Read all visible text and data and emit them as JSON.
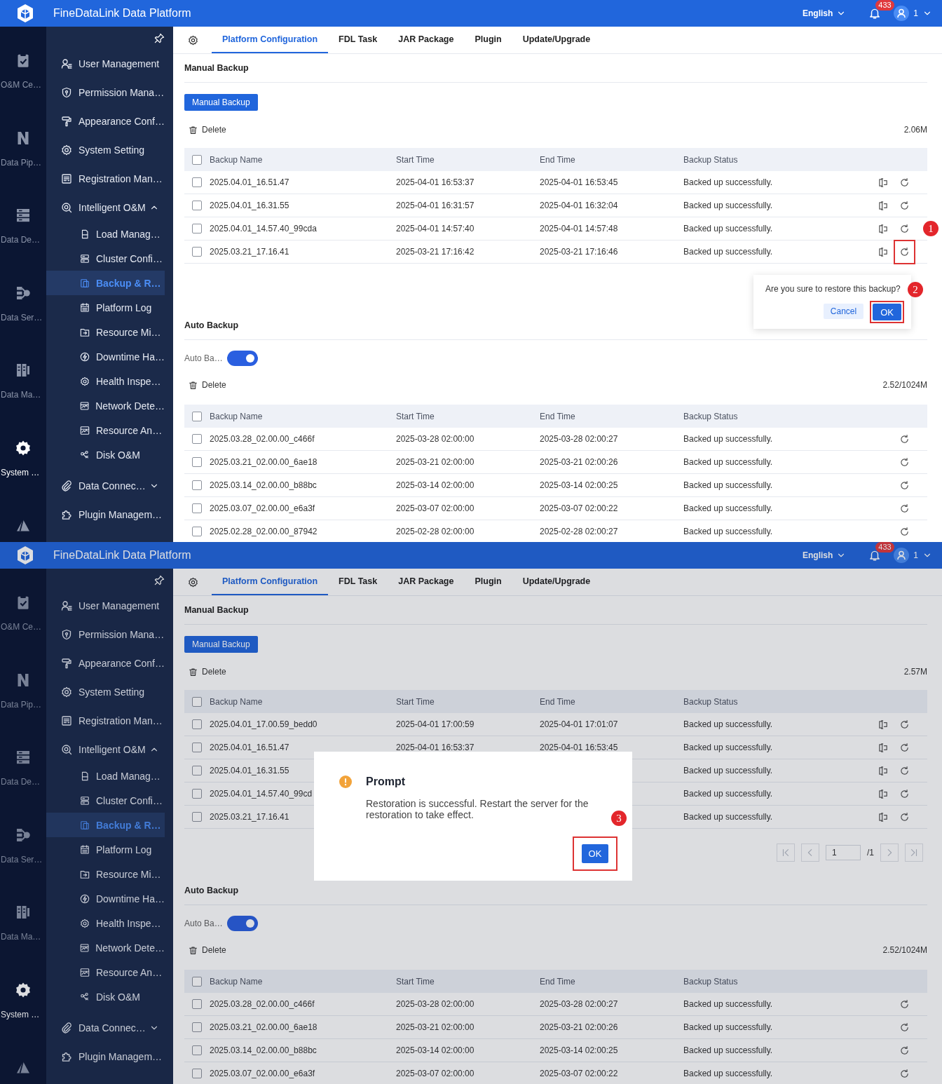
{
  "screens": [
    {
      "header": {
        "title": "FineDataLink Data Platform",
        "language": "English",
        "notifications": "433",
        "user": "1"
      },
      "rail": [
        {
          "label": "O&M Ce…",
          "selected": false
        },
        {
          "label": "Data Pip…",
          "selected": false
        },
        {
          "label": "Data De…",
          "selected": false
        },
        {
          "label": "Data Ser…",
          "selected": false
        },
        {
          "label": "Data Ma…",
          "selected": false
        },
        {
          "label": "System …",
          "selected": true
        },
        {
          "selected": false
        }
      ],
      "sidebar": {
        "items": [
          {
            "label": "User Management",
            "selected": false
          },
          {
            "label": "Permission Mana…",
            "selected": false
          },
          {
            "label": "Appearance Conf…",
            "selected": false
          },
          {
            "label": "System Setting",
            "selected": false
          },
          {
            "label": "Registration Man…",
            "selected": false
          },
          {
            "label": "Intelligent O&M",
            "selected": false,
            "expanded": true,
            "children": [
              {
                "label": "Load Manag…",
                "selected": false
              },
              {
                "label": "Cluster Confi…",
                "selected": false
              },
              {
                "label": "Backup & R…",
                "selected": true
              },
              {
                "label": "Platform Log",
                "selected": false
              },
              {
                "label": "Resource Mi…",
                "selected": false
              },
              {
                "label": "Downtime Ha…",
                "selected": false
              },
              {
                "label": "Health Inspe…",
                "selected": false
              },
              {
                "label": "Network Dete…",
                "selected": false
              },
              {
                "label": "Resource An…",
                "selected": false
              },
              {
                "label": "Disk O&M",
                "selected": false
              }
            ]
          },
          {
            "label": "Data Connec…",
            "selected": false,
            "expanded": false
          },
          {
            "label": "Plugin Managem…",
            "selected": false
          }
        ]
      },
      "tabs": [
        {
          "label": "Platform Configuration",
          "selected": true
        },
        {
          "label": "FDL Task",
          "selected": false
        },
        {
          "label": "JAR Package",
          "selected": false
        },
        {
          "label": "Plugin",
          "selected": false
        },
        {
          "label": "Update/Upgrade",
          "selected": false
        }
      ],
      "manual_backup": {
        "title": "Manual Backup",
        "button": "Manual Backup",
        "delete": "Delete",
        "size": "2.06M",
        "table": {
          "kind": "manual",
          "all_checked": false,
          "columns": [
            "Backup Name",
            "Start Time",
            "End Time",
            "Backup Status"
          ],
          "rows": [
            {
              "checked": false,
              "cells": [
                "2025.04.01_16.51.47",
                "2025-04-01 16:53:37",
                "2025-04-01 16:53:45",
                "Backed up successfully."
              ]
            },
            {
              "checked": false,
              "cells": [
                "2025.04.01_16.31.55",
                "2025-04-01 16:31:57",
                "2025-04-01 16:32:04",
                "Backed up successfully."
              ]
            },
            {
              "checked": false,
              "cells": [
                "2025.04.01_14.57.40_99cda",
                "2025-04-01 14:57:40",
                "2025-04-01 14:57:48",
                "Backed up successfully."
              ],
              "callout": "1"
            },
            {
              "checked": false,
              "cells": [
                "2025.03.21_17.16.41",
                "2025-03-21 17:16:42",
                "2025-03-21 17:16:46",
                "Backed up successfully."
              ],
              "restore_highlighted": true
            }
          ]
        },
        "popconfirm": {
          "text": "Are you sure to restore this backup?",
          "cancel": "Cancel",
          "ok": "OK",
          "ok_highlighted": true,
          "callout": "2"
        }
      },
      "auto_backup": {
        "title": "Auto Backup",
        "toggle": {
          "label": "Auto Ba…",
          "on": true
        },
        "delete": "Delete",
        "size": "2.52/1024M",
        "table": {
          "kind": "auto",
          "all_checked": false,
          "columns": [
            "Backup Name",
            "Start Time",
            "End Time",
            "Backup Status"
          ],
          "rows": [
            {
              "checked": false,
              "cells": [
                "2025.03.28_02.00.00_c466f",
                "2025-03-28 02:00:00",
                "2025-03-28 02:00:27",
                "Backed up successfully."
              ]
            },
            {
              "checked": false,
              "cells": [
                "2025.03.21_02.00.00_6ae18",
                "2025-03-21 02:00:00",
                "2025-03-21 02:00:26",
                "Backed up successfully."
              ]
            },
            {
              "checked": false,
              "cells": [
                "2025.03.14_02.00.00_b88bc",
                "2025-03-14 02:00:00",
                "2025-03-14 02:00:25",
                "Backed up successfully."
              ]
            },
            {
              "checked": false,
              "cells": [
                "2025.03.07_02.00.00_e6a3f",
                "2025-03-07 02:00:00",
                "2025-03-07 02:00:22",
                "Backed up successfully."
              ]
            },
            {
              "checked": false,
              "cells": [
                "2025.02.28_02.00.00_87942",
                "2025-02-28 02:00:00",
                "2025-02-28 02:00:27",
                "Backed up successfully."
              ]
            }
          ]
        }
      }
    },
    {
      "header": {
        "title": "FineDataLink Data Platform",
        "language": "English",
        "notifications": "433",
        "user": "1"
      },
      "rail": [
        {
          "label": "O&M Ce…",
          "selected": false
        },
        {
          "label": "Data Pip…",
          "selected": false
        },
        {
          "label": "Data De…",
          "selected": false
        },
        {
          "label": "Data Ser…",
          "selected": false
        },
        {
          "label": "Data Ma…",
          "selected": false
        },
        {
          "label": "System …",
          "selected": true
        },
        {
          "selected": false
        }
      ],
      "sidebar": {
        "items": [
          {
            "label": "User Management",
            "selected": false
          },
          {
            "label": "Permission Mana…",
            "selected": false
          },
          {
            "label": "Appearance Conf…",
            "selected": false
          },
          {
            "label": "System Setting",
            "selected": false
          },
          {
            "label": "Registration Man…",
            "selected": false
          },
          {
            "label": "Intelligent O&M",
            "selected": false,
            "expanded": true,
            "children": [
              {
                "label": "Load Manag…",
                "selected": false
              },
              {
                "label": "Cluster Confi…",
                "selected": false
              },
              {
                "label": "Backup & R…",
                "selected": true
              },
              {
                "label": "Platform Log",
                "selected": false
              },
              {
                "label": "Resource Mi…",
                "selected": false
              },
              {
                "label": "Downtime Ha…",
                "selected": false
              },
              {
                "label": "Health Inspe…",
                "selected": false
              },
              {
                "label": "Network Dete…",
                "selected": false
              },
              {
                "label": "Resource An…",
                "selected": false
              },
              {
                "label": "Disk O&M",
                "selected": false
              }
            ]
          },
          {
            "label": "Data Connec…",
            "selected": false,
            "expanded": false
          },
          {
            "label": "Plugin Managem…",
            "selected": false
          }
        ]
      },
      "tabs": [
        {
          "label": "Platform Configuration",
          "selected": true
        },
        {
          "label": "FDL Task",
          "selected": false
        },
        {
          "label": "JAR Package",
          "selected": false
        },
        {
          "label": "Plugin",
          "selected": false
        },
        {
          "label": "Update/Upgrade",
          "selected": false
        }
      ],
      "manual_backup": {
        "title": "Manual Backup",
        "button": "Manual Backup",
        "delete": "Delete",
        "size": "2.57M",
        "table": {
          "kind": "manual",
          "all_checked": false,
          "columns": [
            "Backup Name",
            "Start Time",
            "End Time",
            "Backup Status"
          ],
          "rows": [
            {
              "checked": false,
              "cells": [
                "2025.04.01_17.00.59_bedd0",
                "2025-04-01 17:00:59",
                "2025-04-01 17:01:07",
                "Backed up successfully."
              ]
            },
            {
              "checked": false,
              "cells": [
                "2025.04.01_16.51.47",
                "2025-04-01 16:53:37",
                "2025-04-01 16:53:45",
                "Backed up successfully."
              ]
            },
            {
              "checked": false,
              "cells": [
                "2025.04.01_16.31.55",
                null,
                null,
                "Backed up successfully."
              ]
            },
            {
              "checked": false,
              "cells": [
                "2025.04.01_14.57.40_99cd",
                null,
                null,
                "Backed up successfully."
              ]
            },
            {
              "checked": false,
              "cells": [
                "2025.03.21_17.16.41",
                null,
                null,
                "Backed up successfully."
              ]
            }
          ]
        },
        "pagination": {
          "page": "1",
          "total": "/1"
        }
      },
      "auto_backup": {
        "title": "Auto Backup",
        "toggle": {
          "label": "Auto Ba…",
          "on": true
        },
        "delete": "Delete",
        "size": "2.52/1024M",
        "table": {
          "kind": "auto",
          "all_checked": false,
          "columns": [
            "Backup Name",
            "Start Time",
            "End Time",
            "Backup Status"
          ],
          "rows": [
            {
              "checked": false,
              "cells": [
                "2025.03.28_02.00.00_c466f",
                "2025-03-28 02:00:00",
                "2025-03-28 02:00:27",
                "Backed up successfully."
              ]
            },
            {
              "checked": false,
              "cells": [
                "2025.03.21_02.00.00_6ae18",
                "2025-03-21 02:00:00",
                "2025-03-21 02:00:26",
                "Backed up successfully."
              ]
            },
            {
              "checked": false,
              "cells": [
                "2025.03.14_02.00.00_b88bc",
                "2025-03-14 02:00:00",
                "2025-03-14 02:00:25",
                "Backed up successfully."
              ]
            },
            {
              "checked": false,
              "cells": [
                "2025.03.07_02.00.00_e6a3f",
                "2025-03-07 02:00:00",
                "2025-03-07 02:00:22",
                "Backed up successfully."
              ]
            }
          ]
        }
      },
      "modal": {
        "title": "Prompt",
        "message": "Restoration is successful. Restart the server for the restoration to take effect.",
        "ok": "OK",
        "ok_highlighted": true,
        "callout": "3"
      }
    }
  ]
}
